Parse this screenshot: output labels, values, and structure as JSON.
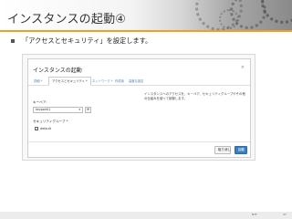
{
  "slide": {
    "title": "インスタンスの起動④",
    "bullet": "「アクセスとセキュリティ」を設定します。",
    "page_number": "37",
    "footer_logo": "NTT"
  },
  "dialog": {
    "title": "インスタンスの起動",
    "close_label": "×",
    "tabs": [
      {
        "label": "詳細 *"
      },
      {
        "label": "アクセスとセキュリティ *"
      },
      {
        "label": "ネットワーク *"
      },
      {
        "label": "作成後"
      },
      {
        "label": "高度な設定"
      }
    ],
    "keypair_label": "キーペア:",
    "keypair_value": "keypair01",
    "keypair_chevron": "▾",
    "add_label": "+",
    "security_group_label": "セキュリティグループ *",
    "security_group_value": "default",
    "checkbox_mark": "✓",
    "help_text": "インスタンスへのアクセスを、キーペア、セキュリティグループやその他の仕組みを使って制御します。",
    "cancel_label": "取り消し",
    "launch_label": "起動"
  },
  "colors": {
    "accent_orange": "#f0a020",
    "primary_button": "#3a80c0",
    "tab_link": "#4a7fb8"
  }
}
